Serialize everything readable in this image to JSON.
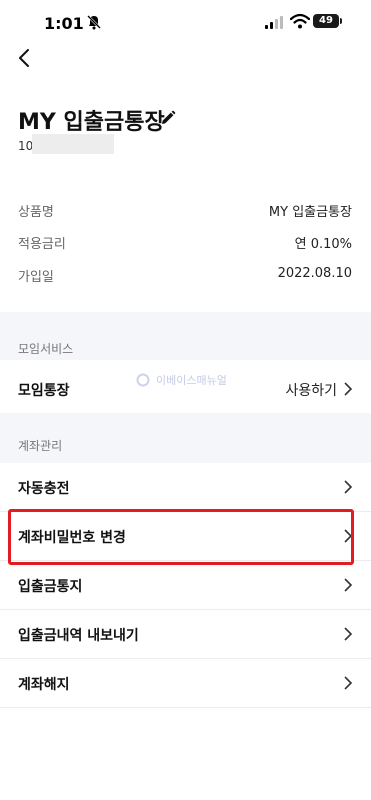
{
  "status_bar": {
    "time": "1:01",
    "battery": "49"
  },
  "header": {
    "title": "MY 입출금통장",
    "account_number_prefix": "10"
  },
  "info": [
    {
      "label": "상품명",
      "value": "MY 입출금통장"
    },
    {
      "label": "적용금리",
      "value": "연 0.10%"
    },
    {
      "label": "가입일",
      "value": "2022.08.10"
    }
  ],
  "group_service": {
    "label": "모임서비스",
    "row": {
      "label": "모임통장",
      "action": "사용하기"
    }
  },
  "watermark": "이베이스매뉴얼",
  "account_management": {
    "label": "계좌관리",
    "items": [
      {
        "label": "자동충전"
      },
      {
        "label": "계좌비밀번호 변경"
      },
      {
        "label": "입출금통지"
      },
      {
        "label": "입출금내역 내보내기"
      },
      {
        "label": "계좌해지"
      }
    ]
  },
  "colors": {
    "highlight": "#e31b23",
    "section_bg": "#f5f6fa"
  }
}
